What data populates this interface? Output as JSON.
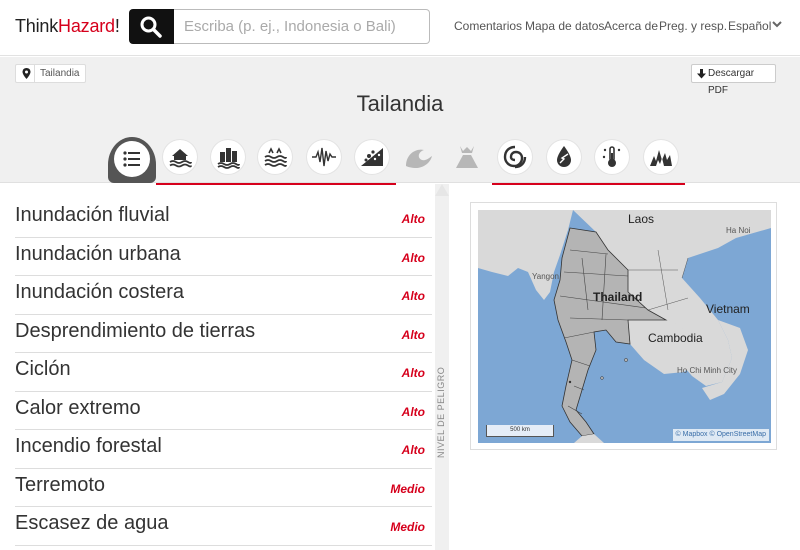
{
  "header": {
    "logo": {
      "think": "Think",
      "hazard": "Hazard",
      "bang": "!"
    },
    "search": {
      "placeholder": "Escriba (p. ej., Indonesia o Bali)"
    },
    "nav": [
      {
        "label": "Comentarios"
      },
      {
        "label": "Mapa de datos"
      },
      {
        "label": "Acerca de"
      },
      {
        "label": "Preg. y resp."
      },
      {
        "label": "Español"
      }
    ]
  },
  "breadcrumb": {
    "label": "Tailandia"
  },
  "download": {
    "label": "Descargar PDF"
  },
  "page_title": "Tailandia",
  "hazard_icons": [
    {
      "icon": "list-icon"
    },
    {
      "icon": "river-flood-icon"
    },
    {
      "icon": "urban-flood-icon"
    },
    {
      "icon": "coastal-flood-icon"
    },
    {
      "icon": "earthquake-icon"
    },
    {
      "icon": "landslide-icon"
    },
    {
      "icon": "tsunami-icon"
    },
    {
      "icon": "volcano-icon"
    },
    {
      "icon": "cyclone-icon"
    },
    {
      "icon": "water-scarcity-icon"
    },
    {
      "icon": "extreme-heat-icon"
    },
    {
      "icon": "wildfire-icon"
    }
  ],
  "hazards": [
    {
      "name": "Inundación fluvial",
      "level": "Alto"
    },
    {
      "name": "Inundación urbana",
      "level": "Alto"
    },
    {
      "name": "Inundación costera",
      "level": "Alto"
    },
    {
      "name": "Desprendimiento de tierras",
      "level": "Alto"
    },
    {
      "name": "Ciclón",
      "level": "Alto"
    },
    {
      "name": "Calor extremo",
      "level": "Alto"
    },
    {
      "name": "Incendio forestal",
      "level": "Alto"
    },
    {
      "name": "Terremoto",
      "level": "Medio"
    },
    {
      "name": "Escasez de agua",
      "level": "Medio"
    }
  ],
  "legend_label": "NIVEL DE PELIGRO",
  "map": {
    "labels": {
      "laos": "Laos",
      "thailand": "Thailand",
      "vietnam": "Vietnam",
      "cambodia": "Cambodia",
      "yangon": "Yangon",
      "hochiminh": "Ho Chi Minh City",
      "hanoi": "Ha Noi"
    },
    "scale": "500 km",
    "attribution": "© Mapbox © OpenStreetMap",
    "colors": {
      "water": "#7da7d4",
      "land": "#d9d9d9",
      "highlight": "#b4b4b4"
    }
  },
  "colors": {
    "accent": "#d6001c",
    "band": "#f0f0f0"
  }
}
